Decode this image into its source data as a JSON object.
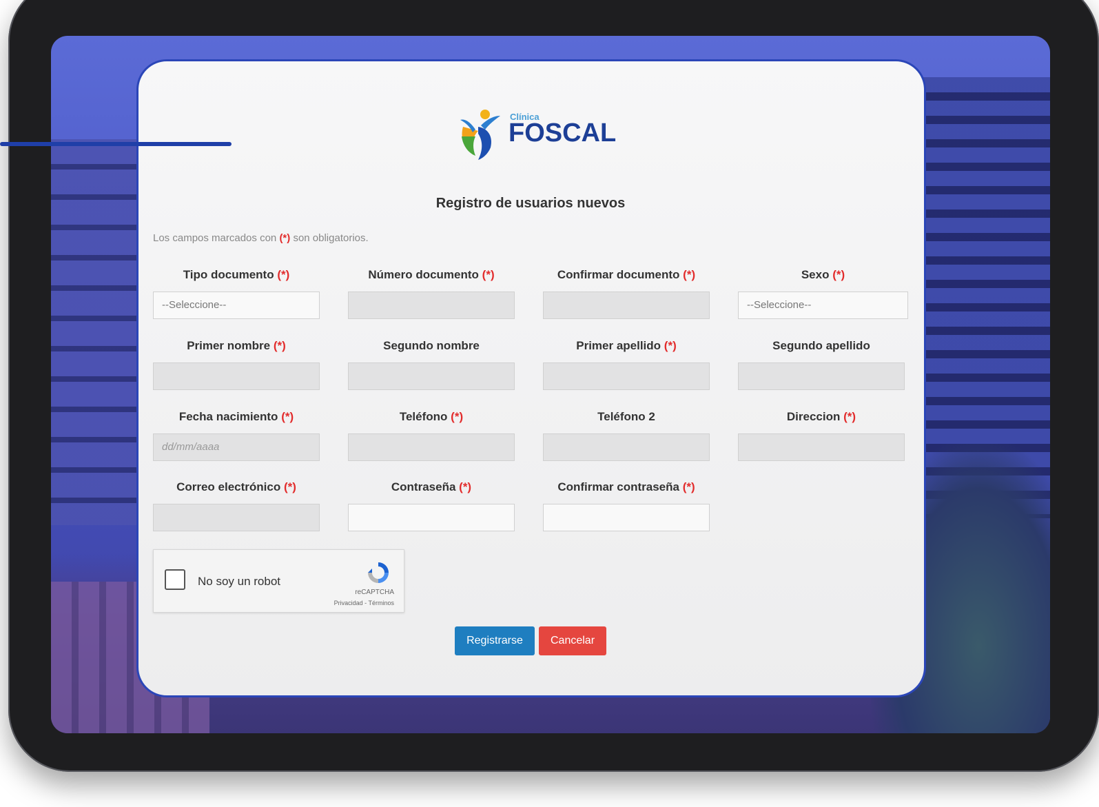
{
  "logo": {
    "small": "Clínica",
    "big": "FOSCAL"
  },
  "form": {
    "title": "Registro de usuarios nuevos",
    "note_prefix": "Los campos marcados con",
    "required_marker": "(*)",
    "note_suffix": "son obligatorios.",
    "fields": [
      {
        "label": "Tipo documento",
        "required": true,
        "value": "--Seleccione--"
      },
      {
        "label": "Número documento",
        "required": true,
        "value": ""
      },
      {
        "label": "Confirmar documento",
        "required": true,
        "value": ""
      },
      {
        "label": "Sexo",
        "required": true,
        "value": "--Seleccione--"
      },
      {
        "label": "Primer nombre",
        "required": true,
        "value": ""
      },
      {
        "label": "Segundo nombre",
        "required": false,
        "value": ""
      },
      {
        "label": "Primer apellido",
        "required": true,
        "value": ""
      },
      {
        "label": "Segundo apellido",
        "required": false,
        "value": ""
      },
      {
        "label": "Fecha nacimiento",
        "required": true,
        "placeholder": "dd/mm/aaaa"
      },
      {
        "label": "Teléfono",
        "required": true,
        "value": ""
      },
      {
        "label": "Teléfono 2",
        "required": false,
        "value": ""
      },
      {
        "label": "Direccion",
        "required": true,
        "value": ""
      },
      {
        "label": "Correo electrónico",
        "required": true,
        "value": ""
      },
      {
        "label": "Contraseña",
        "required": true,
        "value": ""
      },
      {
        "label": "Confirmar contraseña",
        "required": true,
        "value": ""
      }
    ]
  },
  "captcha": {
    "label": "No soy un robot",
    "brand": "reCAPTCHA",
    "links": "Privacidad - Términos"
  },
  "buttons": {
    "register": "Registrarse",
    "cancel": "Cancelar"
  },
  "colors": {
    "primary_button": "#1e7ec0",
    "cancel_button": "#e5463f",
    "required_marker": "#e22b2b",
    "brand": "#1d3f96"
  }
}
